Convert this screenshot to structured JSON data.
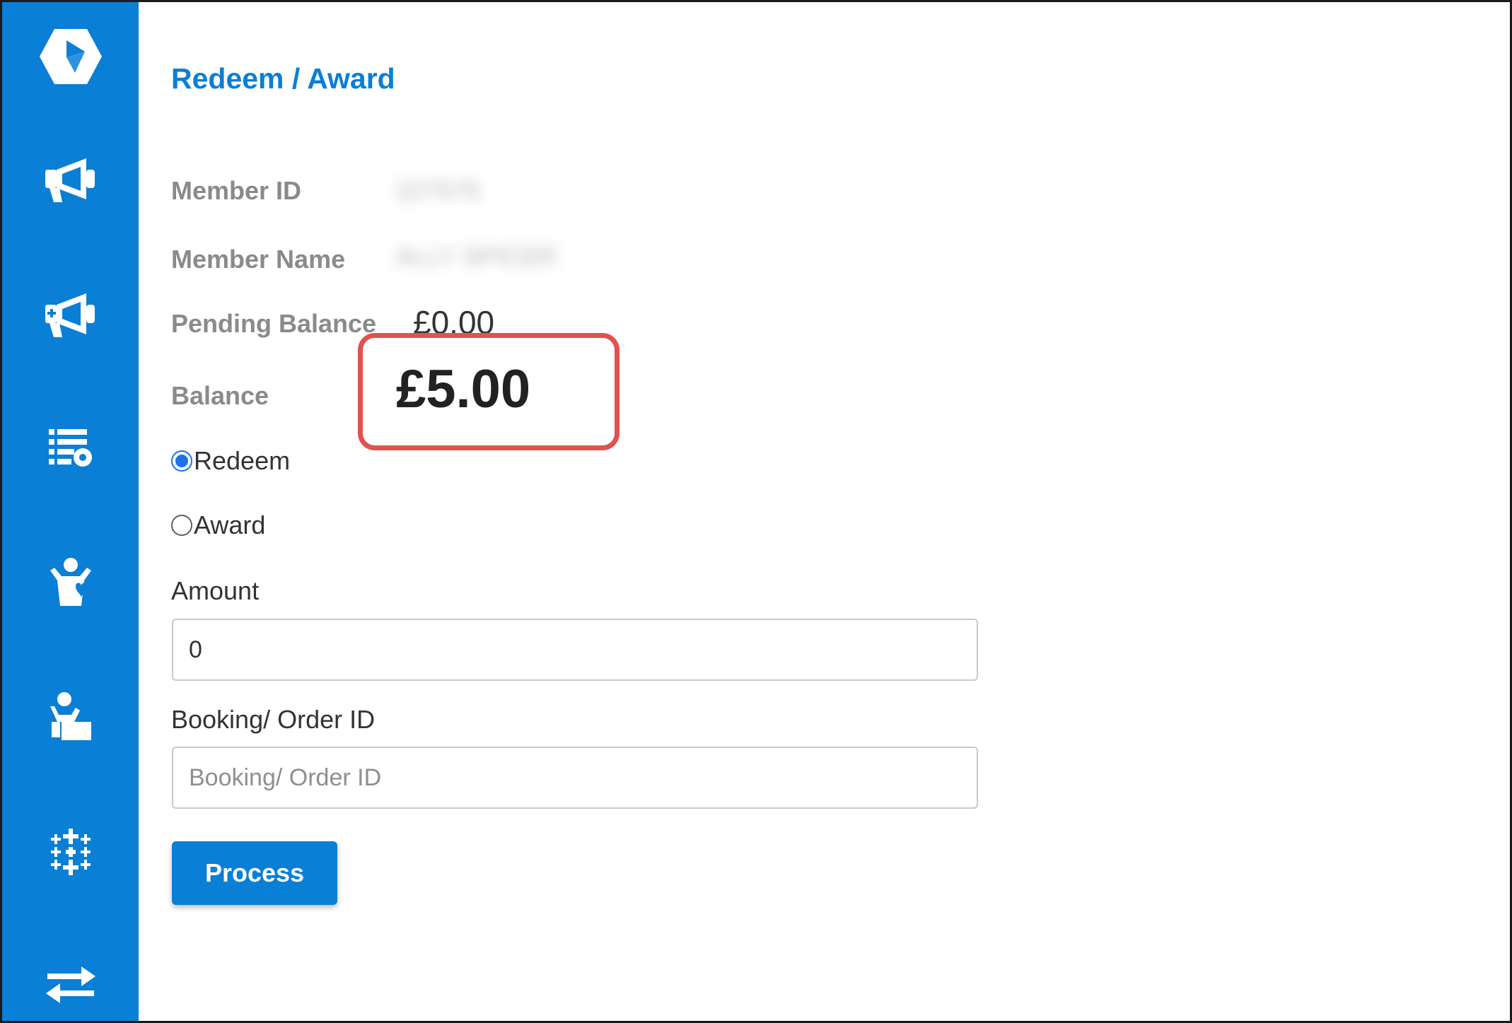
{
  "colors": {
    "brand": "#0a7fd6",
    "highlight": "#e0534f",
    "label_gray": "#8a8a8a"
  },
  "sidebar": {
    "items": [
      {
        "icon": "logo-hexagon-icon"
      },
      {
        "icon": "megaphone-icon"
      },
      {
        "icon": "megaphone-plus-icon"
      },
      {
        "icon": "list-settings-icon"
      },
      {
        "icon": "person-heart-icon"
      },
      {
        "icon": "person-desk-icon"
      },
      {
        "icon": "sparkles-grid-icon"
      },
      {
        "icon": "transfer-arrows-icon"
      }
    ]
  },
  "page": {
    "title": "Redeem / Award"
  },
  "member": {
    "id_label": "Member ID",
    "id_value": "227575",
    "name_label": "Member Name",
    "name_value": "ALLY SPICER",
    "pending_label": "Pending Balance",
    "pending_value": "£0.00",
    "balance_label": "Balance",
    "balance_value": "£5.00"
  },
  "mode": {
    "options": [
      "Redeem",
      "Award"
    ],
    "selected": "Redeem"
  },
  "amount": {
    "label": "Amount",
    "value": "0"
  },
  "booking": {
    "label": "Booking/ Order ID",
    "placeholder": "Booking/ Order ID",
    "value": ""
  },
  "actions": {
    "process_label": "Process"
  }
}
